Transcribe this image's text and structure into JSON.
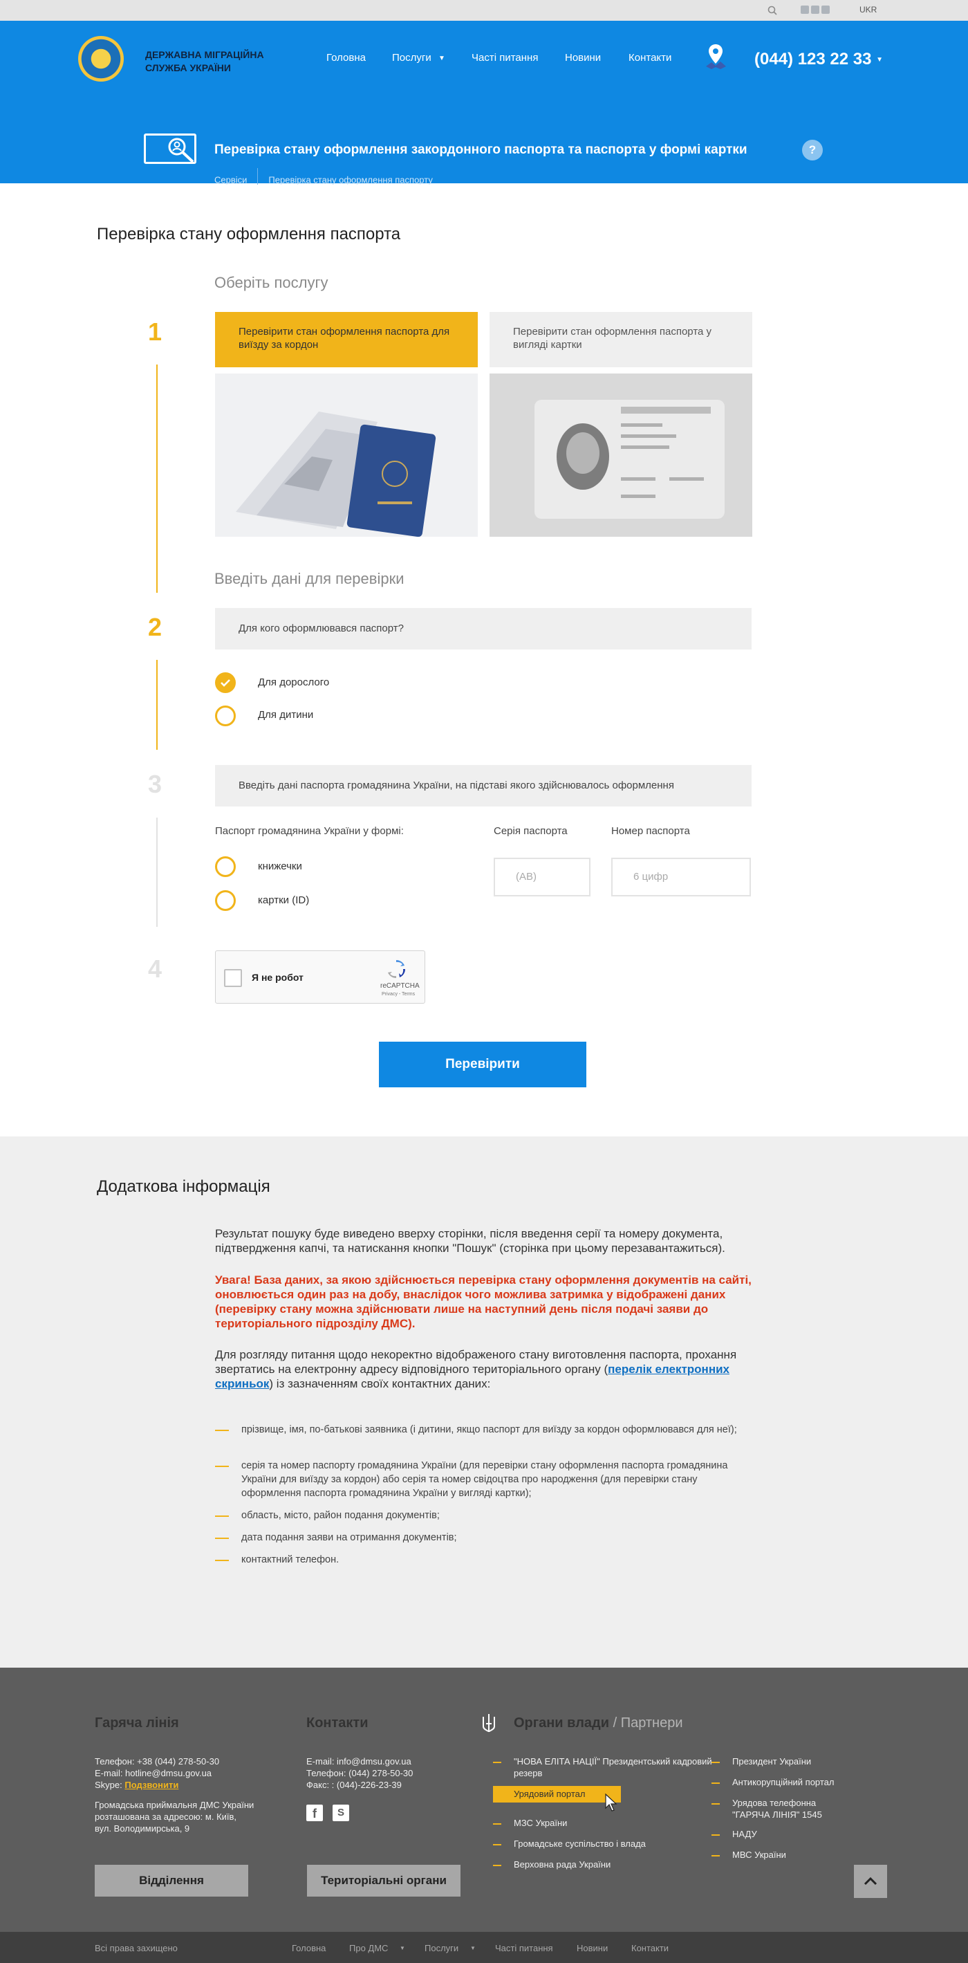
{
  "topbar": {
    "lang": "UKR"
  },
  "header": {
    "org_name_line1": "ДЕРЖАВНА МІГРАЦІЙНА",
    "org_name_line2": "СЛУЖБА УКРАЇНИ",
    "nav": [
      "Головна",
      "Послуги",
      "Часті питання",
      "Новини",
      "Контакти"
    ],
    "phone": "(044) 123 22 33",
    "service_title": "Перевірка стану оформлення закордонного паспорта та паспорта у формі картки",
    "breadcrumbs": [
      "Сервіси",
      "Перевірка стану оформлення паспорту"
    ],
    "help": "?"
  },
  "page": {
    "title": "Перевірка стану оформлення паспорта",
    "choose_service": "Оберіть послугу",
    "steps": [
      "1",
      "2",
      "3",
      "4"
    ],
    "tile1": "Перевірити стан оформлення паспорта для виїзду за кордон",
    "tile2": "Перевірити стан оформлення паспорта у вигляді картки",
    "enter_data": "Введіть дані для перевірки",
    "q_who": "Для кого оформлювався паспорт?",
    "opt_adult": "Для дорослого",
    "opt_child": "Для дитини",
    "q_passport": "Введіть дані паспорта громадянина України, на підставі якого здійснювалось оформлення",
    "form_label": "Паспорт громадянина України у формі:",
    "opt_book": "книжечки",
    "opt_card": "картки (ID)",
    "series_label": "Серія паспорта",
    "series_placeholder": "(АВ)",
    "number_label": "Номер паспорта",
    "number_placeholder": "6 цифр",
    "captcha_label": "Я не робот",
    "captcha_brand": "reCAPTCHA",
    "captcha_links": "Privacy - Terms",
    "submit": "Перевірити"
  },
  "info": {
    "title": "Додаткова інформація",
    "p1": "Результат пошуку буде виведено вверху сторінки, після введення серії та номеру документа, підтвердження капчі, та натискання кнопки \"Пошук\" (сторінка при цьому перезавантажиться).",
    "p2": "Увага! База даних, за якою здійснюється перевірка стану оформлення документів на сайті, оновлюється один раз на добу, внаслідок чого можлива затримка у відображені даних (перевірку стану можна здійснювати лише на наступний день після подачі заяви до територіального підрозділу ДМС).",
    "p3_a": "Для розгляду питання щодо некоректно відображеного стану виготовлення паспорта, прохання звертатись на електронну адресу відповідного територіального органу (",
    "p3_link": "перелік електронних скриньок",
    "p3_b": ") із зазначенням своїх контактних даних:",
    "bullets": [
      "прізвище, імя, по-батькові заявника (і дитини, якщо паспорт для виїзду за кордон оформлювався для неї);",
      "серія та номер паспорту громадянина України (для перевірки стану оформлення паспорта громадянина України для виїзду за кордон) або серія та номер свідоцтва про народження (для перевірки стану оформлення паспорта громадянина України у вигляді картки);",
      "область, місто, район подання документів;",
      "дата подання заяви на отримання документів;",
      "контактний телефон."
    ]
  },
  "footer": {
    "hotline_title": "Гаряча лінія",
    "hotline_phone": "Телефон: +38 (044) 278-50-30",
    "hotline_email": "E-mail: hotline@dmsu.gov.ua",
    "skype_label": "Skype:",
    "skype_link": "Подзвонити",
    "address1": "Громадська приймальня ДМС України",
    "address2": "розташована за адресою: м. Київ,",
    "address3": "вул. Володимирська, 9",
    "contacts_title": "Контакти",
    "contacts_email": "E-mail: info@dmsu.gov.ua",
    "contacts_phone": "Телефон: (044) 278-50-30",
    "contacts_fax": "Факс: : (044)-226-23-39",
    "authorities_title": "Органи влади",
    "partners_title": "/ Партнери",
    "links_col1": [
      "\"НОВА ЕЛІТА НАЦІЇ\" Президентський кадровий резерв",
      "Урядовий портал",
      "МЗС України",
      "Громадське суспільство і влада",
      "Верховна рада України"
    ],
    "links_col2": [
      "Президент України",
      "Антикорупційний портал",
      "Урядова телефонна \"ГАРЯЧА ЛІНІЯ\" 1545",
      "НАДУ",
      "МВС України"
    ],
    "btn_departments": "Відділення",
    "btn_territorial": "Територіальні органи",
    "copyright": "Всі права захищено",
    "bottom_nav": [
      "Головна",
      "Про ДМС",
      "Послуги",
      "Часті питання",
      "Новини",
      "Контакти"
    ]
  },
  "colors": {
    "brand_blue": "#0f88e2",
    "accent_yellow": "#f1b41a",
    "footer_gray": "#5d5d5d"
  }
}
